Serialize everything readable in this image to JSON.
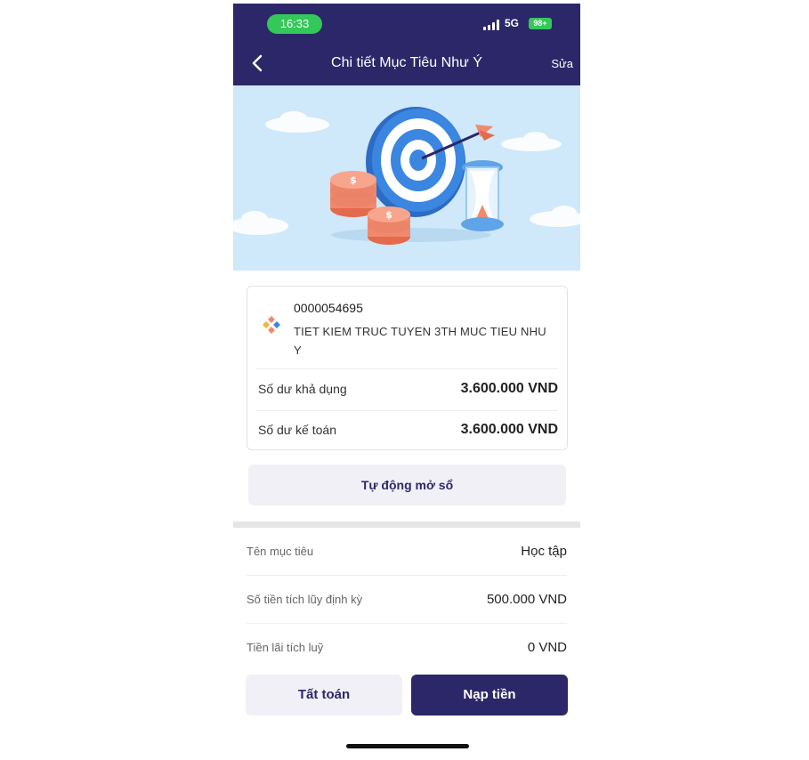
{
  "status_bar": {
    "time": "16:33",
    "network": "5G",
    "battery": "98+"
  },
  "nav": {
    "title": "Chi tiết Mục Tiêu Như Ý",
    "edit_label": "Sửa"
  },
  "account": {
    "number": "0000054695",
    "name": "TIET KIEM TRUC TUYEN 3TH MUC TIEU NHU Y",
    "available_balance_label": "Số dư khả dụng",
    "available_balance_value": "3.600.000 VND",
    "ledger_balance_label": "Số dư kế toán",
    "ledger_balance_value": "3.600.000 VND"
  },
  "auto_open_label": "Tự động mở sổ",
  "goal_info": [
    {
      "label": "Tên mục tiêu",
      "value": "Học tập"
    },
    {
      "label": "Số tiền tích lũy định kỳ",
      "value": "500.000 VND"
    },
    {
      "label": "Tiền lãi tích luỹ",
      "value": "0 VND"
    }
  ],
  "actions": {
    "settle_label": "Tất toán",
    "deposit_label": "Nạp tiền"
  },
  "colors": {
    "primary": "#2c2768",
    "banner_bg": "#cfe8fa",
    "status_green": "#34c759",
    "coin": "#f08a6e"
  }
}
